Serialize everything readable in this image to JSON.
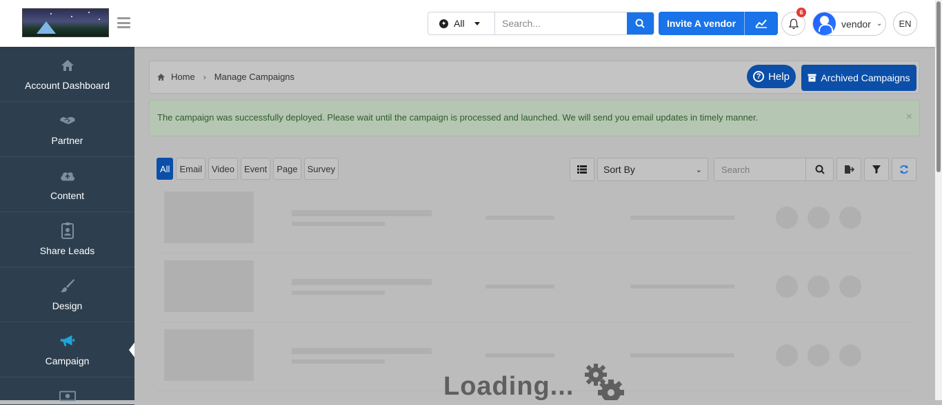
{
  "header": {
    "search_scope": "All",
    "search_placeholder": "Search...",
    "invite_label": "Invite A vendor",
    "notification_count": "6",
    "user_name": "vendor",
    "language": "EN"
  },
  "sidebar": {
    "items": [
      {
        "label": "Account Dashboard",
        "icon": "home-icon"
      },
      {
        "label": "Partner",
        "icon": "handshake-icon"
      },
      {
        "label": "Content",
        "icon": "cloud-upload-icon"
      },
      {
        "label": "Share Leads",
        "icon": "id-badge-icon"
      },
      {
        "label": "Design",
        "icon": "paintbrush-icon"
      },
      {
        "label": "Campaign",
        "icon": "megaphone-icon",
        "active": true
      },
      {
        "label": "",
        "icon": "money-icon"
      }
    ]
  },
  "breadcrumb": {
    "home": "Home",
    "current": "Manage Campaigns"
  },
  "actions": {
    "help": "Help",
    "archived": "Archived Campaigns"
  },
  "alert": {
    "message": "The campaign was successfully deployed. Please wait until the campaign is processed and launched. We will send you email updates in timely manner.",
    "close": "×"
  },
  "filters": {
    "tabs": [
      "All",
      "Email",
      "Video",
      "Event",
      "Page",
      "Survey"
    ],
    "active": "All"
  },
  "toolbar": {
    "sort_label": "Sort By",
    "search_placeholder": "Search"
  },
  "loading": {
    "text": "Loading..."
  },
  "colors": {
    "primary": "#1a73e8",
    "sidebar": "#2d3f4f",
    "active_icon": "#1ea7d6",
    "badge": "#e53935"
  }
}
